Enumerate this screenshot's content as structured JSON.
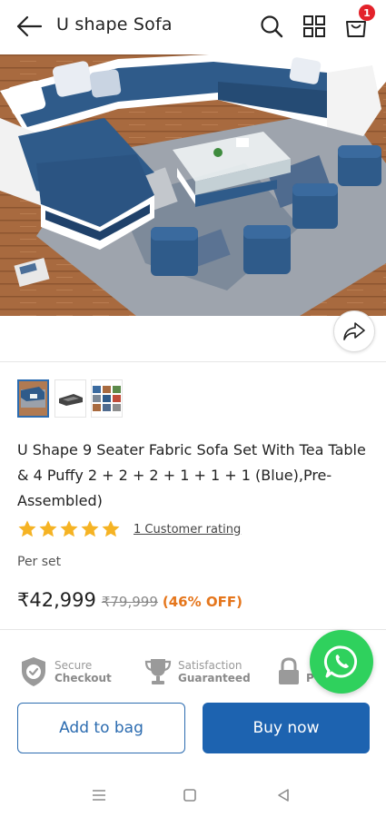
{
  "header": {
    "title": "U shape Sofa",
    "cart_count": "1"
  },
  "product": {
    "title": "U Shape 9 Seater Fabric Sofa Set With Tea Table & 4 Puffy 2 + 2 + 2 + 1 + 1 + 1 (Blue),Pre-Assembled)",
    "rating_stars": 5,
    "rating_text": "1 Customer rating",
    "unit": "Per set",
    "price": "₹42,999",
    "mrp": "₹79,999",
    "discount": "(46% OFF)"
  },
  "trust": {
    "secure_line1": "Secure",
    "secure_line2": "Checkout",
    "satisfaction_line1": "Satisfaction",
    "satisfaction_line2": "Guaranteed",
    "third_line2": "P"
  },
  "actions": {
    "add_to_bag": "Add to bag",
    "buy_now": "Buy now"
  },
  "colors": {
    "accent": "#1d63b0",
    "discount": "#e5761c",
    "badge": "#e3222a",
    "whatsapp": "#2fd15d",
    "star": "#f5b324"
  }
}
